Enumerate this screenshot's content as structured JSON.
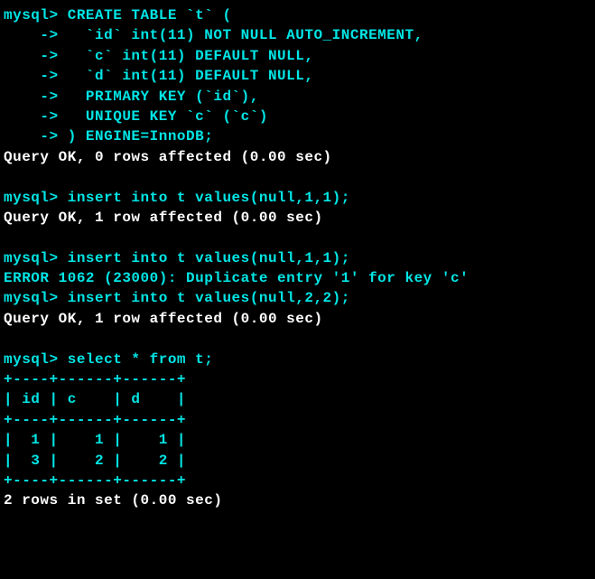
{
  "session": {
    "prompt": "mysql>",
    "cont": "    ->",
    "create_stmt": {
      "l0": " CREATE TABLE `t` (",
      "l1": "   `id` int(11) NOT NULL AUTO_INCREMENT,",
      "l2": "   `c` int(11) DEFAULT NULL,",
      "l3": "   `d` int(11) DEFAULT NULL,",
      "l4": "   PRIMARY KEY (`id`),",
      "l5": "   UNIQUE KEY `c` (`c`)",
      "l6": " ) ENGINE=InnoDB;"
    },
    "create_result": "Query OK, 0 rows affected (0.00 sec)",
    "blank": " ",
    "insert1_cmd": " insert into t values(null,1,1);",
    "insert1_result": "Query OK, 1 row affected (0.00 sec)",
    "insert2_cmd": " insert into t values(null,1,1);",
    "insert2_error": "ERROR 1062 (23000): Duplicate entry '1' for key 'c'",
    "insert3_cmd": " insert into t values(null,2,2);",
    "insert3_result": "Query OK, 1 row affected (0.00 sec)",
    "select_cmd": " select * from t;",
    "table": {
      "border": "+----+------+------+",
      "header": "| id | c    | d    |",
      "row1": "|  1 |    1 |    1 |",
      "row2": "|  3 |    2 |    2 |"
    },
    "select_result": "2 rows in set (0.00 sec)"
  },
  "chart_data": {
    "type": "table",
    "title": "select * from t",
    "columns": [
      "id",
      "c",
      "d"
    ],
    "rows": [
      {
        "id": 1,
        "c": 1,
        "d": 1
      },
      {
        "id": 3,
        "c": 2,
        "d": 2
      }
    ]
  }
}
